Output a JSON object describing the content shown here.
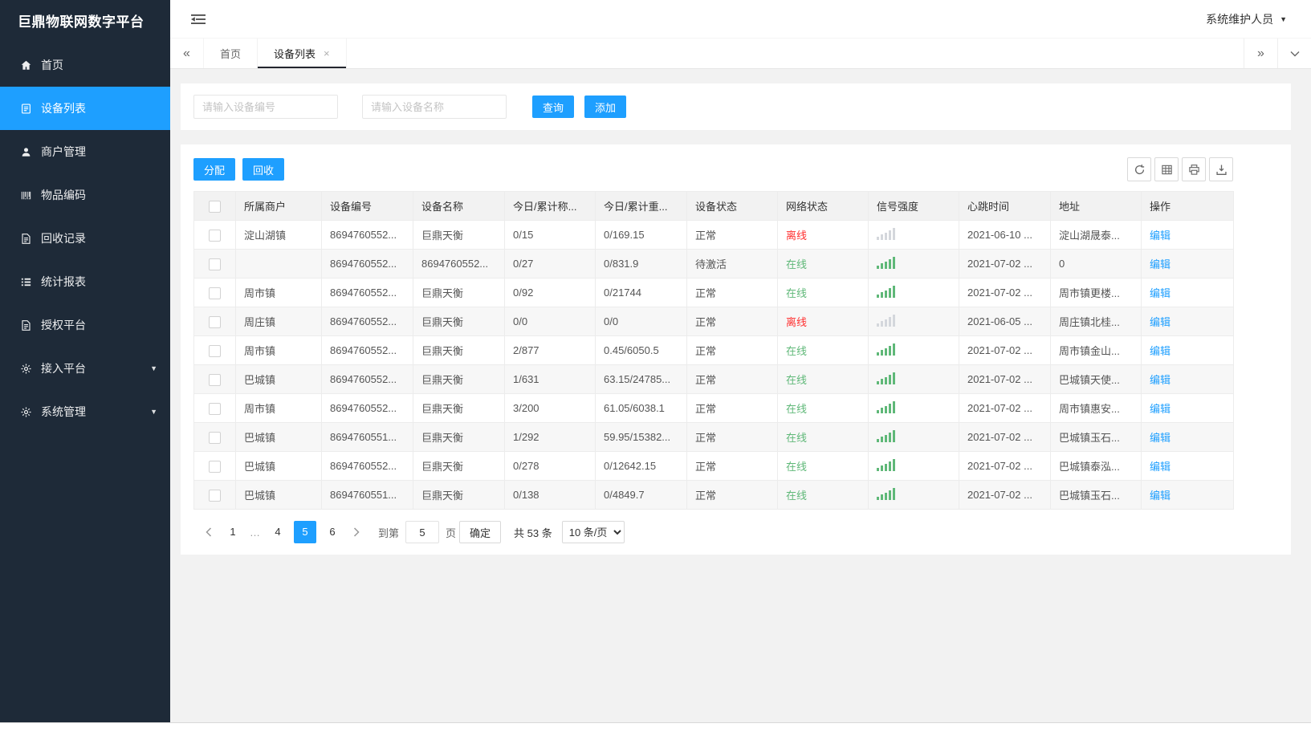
{
  "colors": {
    "accent": "#1E9FFF",
    "online_green": "#5FB878",
    "offline_red": "#FF3030",
    "sidebar_bg": "#1E2A38"
  },
  "icons": {
    "tabs_scroll_left": "«",
    "tabs_scroll_right": "»",
    "tab_close": "×",
    "caret_down": "▼"
  },
  "app": {
    "title": "巨鼎物联网数字平台",
    "user_role": "系统维护人员"
  },
  "sidebar": {
    "items": [
      {
        "key": "home",
        "label": "首页",
        "icon": "home-icon",
        "active": false,
        "expandable": false
      },
      {
        "key": "device-list",
        "label": "设备列表",
        "icon": "list-icon",
        "active": true,
        "expandable": false
      },
      {
        "key": "merchant-management",
        "label": "商户管理",
        "icon": "user-icon",
        "active": false,
        "expandable": false
      },
      {
        "key": "item-code",
        "label": "物品编码",
        "icon": "barcode-icon",
        "active": false,
        "expandable": false
      },
      {
        "key": "recycle-records",
        "label": "回收记录",
        "icon": "doc-icon",
        "active": false,
        "expandable": false
      },
      {
        "key": "statistics-report",
        "label": "统计报表",
        "icon": "report-icon",
        "active": false,
        "expandable": false
      },
      {
        "key": "authorization-platform",
        "label": "授权平台",
        "icon": "doc-icon",
        "active": false,
        "expandable": false
      },
      {
        "key": "access-platform",
        "label": "接入平台",
        "icon": "gear-icon",
        "active": false,
        "expandable": true
      },
      {
        "key": "system-management",
        "label": "系统管理",
        "icon": "gear-icon",
        "active": false,
        "expandable": true
      }
    ]
  },
  "tabs": [
    {
      "key": "home",
      "label": "首页",
      "active": false,
      "closable": false
    },
    {
      "key": "device-list",
      "label": "设备列表",
      "active": true,
      "closable": true
    }
  ],
  "search": {
    "device_no_placeholder": "请输入设备编号",
    "device_name_placeholder": "请输入设备名称",
    "query_label": "查询",
    "add_label": "添加"
  },
  "toolbar": {
    "allocate_label": "分配",
    "recycle_label": "回收",
    "icon_buttons": [
      "refresh-icon",
      "grid-icon",
      "print-icon",
      "export-icon"
    ]
  },
  "table": {
    "headers": [
      "所属商户",
      "设备编号",
      "设备名称",
      "今日/累计称...",
      "今日/累计重...",
      "设备状态",
      "网络状态",
      "信号强度",
      "心跳时间",
      "地址",
      "操作"
    ],
    "rows": [
      {
        "merchant": "淀山湖镇",
        "device_no": "8694760552...",
        "device_name": "巨鼎天衡",
        "today_total_count": "0/15",
        "today_total_weight": "0/169.15",
        "device_status": "正常",
        "network_status": "离线",
        "online": false,
        "signal": "weak",
        "heartbeat": "2021-06-10 ...",
        "address": "淀山湖晟泰...",
        "action": "编辑"
      },
      {
        "merchant": "",
        "device_no": "8694760552...",
        "device_name": "8694760552...",
        "today_total_count": "0/27",
        "today_total_weight": "0/831.9",
        "device_status": "待激活",
        "network_status": "在线",
        "online": true,
        "signal": "strong",
        "heartbeat": "2021-07-02 ...",
        "address": "0",
        "action": "编辑"
      },
      {
        "merchant": "周市镇",
        "device_no": "8694760552...",
        "device_name": "巨鼎天衡",
        "today_total_count": "0/92",
        "today_total_weight": "0/21744",
        "device_status": "正常",
        "network_status": "在线",
        "online": true,
        "signal": "strong",
        "heartbeat": "2021-07-02 ...",
        "address": "周市镇更楼...",
        "action": "编辑"
      },
      {
        "merchant": "周庄镇",
        "device_no": "8694760552...",
        "device_name": "巨鼎天衡",
        "today_total_count": "0/0",
        "today_total_weight": "0/0",
        "device_status": "正常",
        "network_status": "离线",
        "online": false,
        "signal": "weak",
        "heartbeat": "2021-06-05 ...",
        "address": "周庄镇北桂...",
        "action": "编辑"
      },
      {
        "merchant": "周市镇",
        "device_no": "8694760552...",
        "device_name": "巨鼎天衡",
        "today_total_count": "2/877",
        "today_total_weight": "0.45/6050.5",
        "device_status": "正常",
        "network_status": "在线",
        "online": true,
        "signal": "strong",
        "heartbeat": "2021-07-02 ...",
        "address": "周市镇金山...",
        "action": "编辑"
      },
      {
        "merchant": "巴城镇",
        "device_no": "8694760552...",
        "device_name": "巨鼎天衡",
        "today_total_count": "1/631",
        "today_total_weight": "63.15/24785...",
        "device_status": "正常",
        "network_status": "在线",
        "online": true,
        "signal": "strong",
        "heartbeat": "2021-07-02 ...",
        "address": "巴城镇天使...",
        "action": "编辑"
      },
      {
        "merchant": "周市镇",
        "device_no": "8694760552...",
        "device_name": "巨鼎天衡",
        "today_total_count": "3/200",
        "today_total_weight": "61.05/6038.1",
        "device_status": "正常",
        "network_status": "在线",
        "online": true,
        "signal": "strong",
        "heartbeat": "2021-07-02 ...",
        "address": "周市镇惠安...",
        "action": "编辑"
      },
      {
        "merchant": "巴城镇",
        "device_no": "8694760551...",
        "device_name": "巨鼎天衡",
        "today_total_count": "1/292",
        "today_total_weight": "59.95/15382...",
        "device_status": "正常",
        "network_status": "在线",
        "online": true,
        "signal": "strong",
        "heartbeat": "2021-07-02 ...",
        "address": "巴城镇玉石...",
        "action": "编辑"
      },
      {
        "merchant": "巴城镇",
        "device_no": "8694760552...",
        "device_name": "巨鼎天衡",
        "today_total_count": "0/278",
        "today_total_weight": "0/12642.15",
        "device_status": "正常",
        "network_status": "在线",
        "online": true,
        "signal": "strong",
        "heartbeat": "2021-07-02 ...",
        "address": "巴城镇泰泓...",
        "action": "编辑"
      },
      {
        "merchant": "巴城镇",
        "device_no": "8694760551...",
        "device_name": "巨鼎天衡",
        "today_total_count": "0/138",
        "today_total_weight": "0/4849.7",
        "device_status": "正常",
        "network_status": "在线",
        "online": true,
        "signal": "strong",
        "heartbeat": "2021-07-02 ...",
        "address": "巴城镇玉石...",
        "action": "编辑"
      }
    ]
  },
  "pagination": {
    "pages": [
      "1",
      "…",
      "4",
      "5",
      "6"
    ],
    "active_page": "5",
    "jump_prefix": "到第",
    "jump_value": "5",
    "jump_suffix": "页",
    "confirm_label": "确定",
    "total_label": "共 53 条",
    "page_size_label": "10 条/页"
  }
}
